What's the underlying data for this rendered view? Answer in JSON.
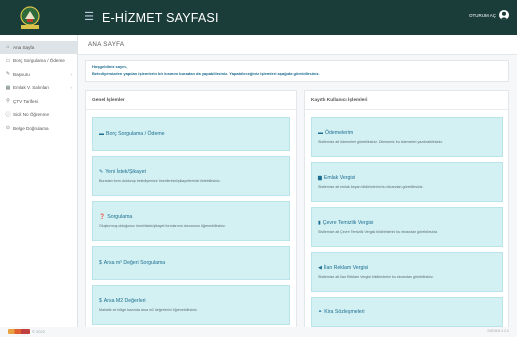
{
  "header": {
    "title": "E-HİZMET SAYFASI",
    "menu_icon": "hamburger-icon",
    "user_label": "OTURUM AÇ",
    "logo_icon": "municipality-logo-icon",
    "colors": {
      "topbar": "#1a3d3a",
      "accent": "#1c6f90",
      "card": "#d3f0f3"
    }
  },
  "sidebar": {
    "items": [
      {
        "label": "Ana Sayfa",
        "icon": "home-icon",
        "active": true
      },
      {
        "label": "Borç Sorgulama / Ödeme",
        "icon": "card-icon"
      },
      {
        "label": "Başvuru",
        "icon": "pencil-icon",
        "arrow": "‹"
      },
      {
        "label": "Emlak V. Salınları",
        "icon": "grid-icon",
        "arrow": "‹"
      },
      {
        "label": "ÇTV Tarifesi",
        "icon": "pin-icon"
      },
      {
        "label": "Sicil No Öğrenme",
        "icon": "info-icon"
      },
      {
        "label": "Belge Doğrulama",
        "icon": "check-icon"
      }
    ]
  },
  "main": {
    "page_title": "ANA SAYFA",
    "welcome": {
      "title": "Hoşgeldiniz sayın,",
      "text": "Belediyemizden yapılan işlemlerin bir kısmını buradan da yapabilirsiniz. Yapabileceğiniz işlemleri aşağıda görebilirsiniz."
    },
    "general": {
      "heading": "Genel İşlemler",
      "cards": [
        {
          "title": "Borç Sorgulama / Ödeme",
          "icon": "card-icon",
          "desc": ""
        },
        {
          "title": "Yeni İstek/Şikayet",
          "icon": "pencil-icon",
          "desc": "Buradan form doldurup belediyemize önerilerinizi/şikayetlerinizi iletebilirsiniz."
        },
        {
          "title": "Sorgulama",
          "icon": "question-icon",
          "desc": "Oluşturmuş olduğunuz öneri/istek/şikayet formlarının durumunu öğrenebilirsiniz."
        },
        {
          "title": "Arsa m² Değeri Sorgulama",
          "icon": "dollar-icon",
          "desc": ""
        },
        {
          "title": "Arsa M2 Değerleri",
          "icon": "dollar-icon",
          "desc": "Mahalle ve bölge bazında arsa m2 değerlerini öğrenebilirsiniz."
        }
      ]
    },
    "registered": {
      "heading": "Kayıtlı Kullanıcı İşlemleri",
      "cards": [
        {
          "title": "Ödemelerim",
          "icon": "card-icon",
          "desc": "Sistlemize ait ödemeleri görebilirsiniz. Dilerseniz bu ödemeleri yazdırabilirsiniz."
        },
        {
          "title": "Emlak Vergisi",
          "icon": "building-icon",
          "desc": "Sistlemize ait emlak beyan bildirimlerini bu ekrandan görebilirsiniz."
        },
        {
          "title": "Çevre Temizlik Vergisi",
          "icon": "trash-icon",
          "desc": "Sistlemize ait Çevre Temizlik Vergisi bildirimlerini bu ekrandan görebilirsiniz."
        },
        {
          "title": "İlan Reklam Vergisi",
          "icon": "bullhorn-icon",
          "desc": "Sistlemize ait İlan Reklam Vergisi bildirimlerini bu ekrandan görebilirsiniz."
        },
        {
          "title": "Kira Sözleşmeleri",
          "icon": "handshake-icon",
          "desc": ""
        }
      ]
    }
  },
  "footer": {
    "copyright": "© 2022",
    "version": "SÜRÜM 2.2.0"
  }
}
